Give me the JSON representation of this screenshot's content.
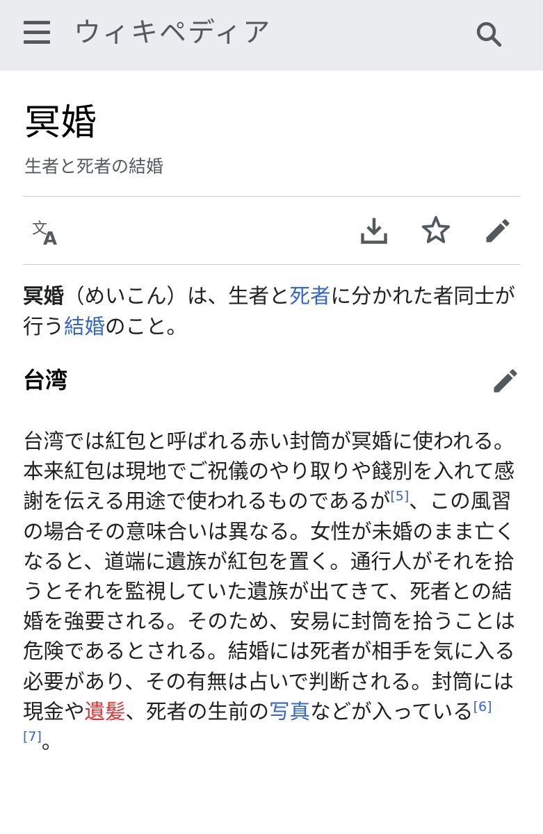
{
  "header": {
    "logo": "ウィキペディア",
    "menu_icon": "hamburger-menu-icon",
    "search_icon": "search-icon"
  },
  "page": {
    "title": "冥婚",
    "subtitle": "生者と死者の結婚"
  },
  "toolbar": {
    "language_icon": "language-icon",
    "download_icon": "download-icon",
    "watch_icon": "star-icon",
    "edit_icon": "pencil-icon"
  },
  "lead": {
    "term": "冥婚",
    "t1": "（めいこん）は、生者と",
    "link_shisha": "死者",
    "t2": "に分かれた者同士が行う",
    "link_kekkon": "結婚",
    "t3": "のこと。"
  },
  "section": {
    "heading": "台湾",
    "t1": "台湾では紅包と呼ばれる赤い封筒が冥婚に使われる。本来紅包は現地でご祝儀のやり取りや餞別を入れて感謝を伝える用途で使われるものであるが",
    "ref5": "[5]",
    "t2": "、この風習の場合その意味合いは異なる。女性が未婚のまま亡くなると、道端に遺族が紅包を置く。通行人がそれを拾うとそれを監視していた遺族が出てきて、死者との結婚を強要される。そのため、安易に封筒を拾うことは危険であるとされる。結婚には死者が相手を気に入る必要があり、その有無は占いで判断される。封筒には現金や",
    "link_ihatsu": "遺髪",
    "t3": "、死者の生前の",
    "link_shashin": "写真",
    "t4": "などが入っている",
    "ref6": "[6]",
    "ref7": "[7]",
    "t5": "。"
  },
  "colors": {
    "link": "#3366cc",
    "redlink": "#dd3333",
    "header_bg": "#eaecf0",
    "icon": "#54595d"
  }
}
